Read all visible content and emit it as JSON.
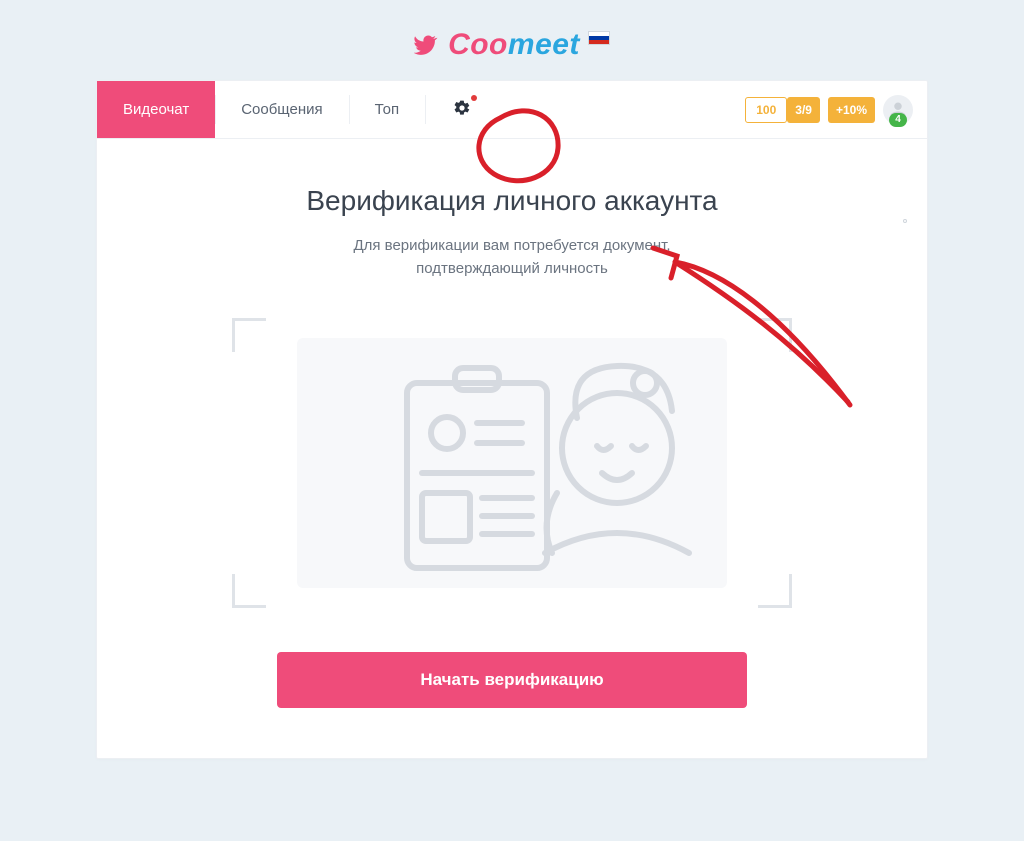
{
  "brand": {
    "part1": "Coo",
    "part2": "meet"
  },
  "tabs": {
    "videochat": "Видеочат",
    "messages": "Сообщения",
    "top": "Топ"
  },
  "chips": {
    "credits": "100",
    "ratio": "3/9",
    "bonus": "+10%",
    "avatar_count": "4"
  },
  "verify": {
    "title": "Верификация личного аккаунта",
    "subtitle_line1": "Для верификации вам потребуется документ,",
    "subtitle_line2": "подтверждающий личность",
    "cta": "Начать верификацию"
  }
}
